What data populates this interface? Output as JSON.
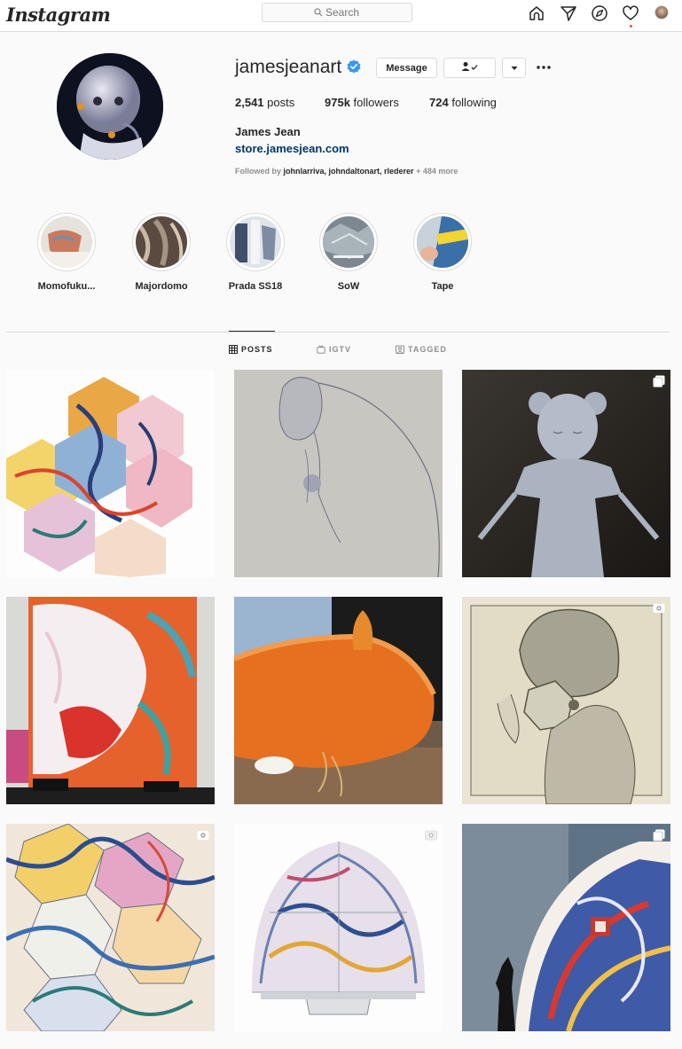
{
  "nav": {
    "logo": "Instagram",
    "search_placeholder": "Search",
    "icons": [
      "home-icon",
      "direct-icon",
      "explore-icon",
      "activity-heart-icon",
      "profile-avatar"
    ],
    "notification_color": "#ed4956"
  },
  "profile": {
    "username": "jamesjeanart",
    "verified": true,
    "message_label": "Message",
    "stats": {
      "posts_count": "2,541",
      "posts_label": "posts",
      "followers_count": "975k",
      "followers_label": "followers",
      "following_count": "724",
      "following_label": "following"
    },
    "full_name": "James Jean",
    "website": "store.jamesjean.com",
    "followed_by_prefix": "Followed by",
    "followed_by_names": "johnlarriva, johndaltonart, rlederer",
    "followed_by_more": "+ 484 more"
  },
  "highlights": [
    {
      "label": "Momofuku..."
    },
    {
      "label": "Majordomo"
    },
    {
      "label": "Prada SS18"
    },
    {
      "label": "SoW"
    },
    {
      "label": "Tape"
    }
  ],
  "tabs": [
    {
      "label": "POSTS",
      "active": true
    },
    {
      "label": "IGTV",
      "active": false
    },
    {
      "label": "TAGGED",
      "active": false
    }
  ],
  "posts": [
    {
      "type": "image"
    },
    {
      "type": "image"
    },
    {
      "type": "carousel"
    },
    {
      "type": "image"
    },
    {
      "type": "image"
    },
    {
      "type": "video"
    },
    {
      "type": "video"
    },
    {
      "type": "video"
    },
    {
      "type": "carousel"
    }
  ],
  "colors": {
    "link": "#00376b",
    "verified": "#3897f0",
    "border": "#dbdbdb",
    "muted": "#8e8e8e"
  }
}
